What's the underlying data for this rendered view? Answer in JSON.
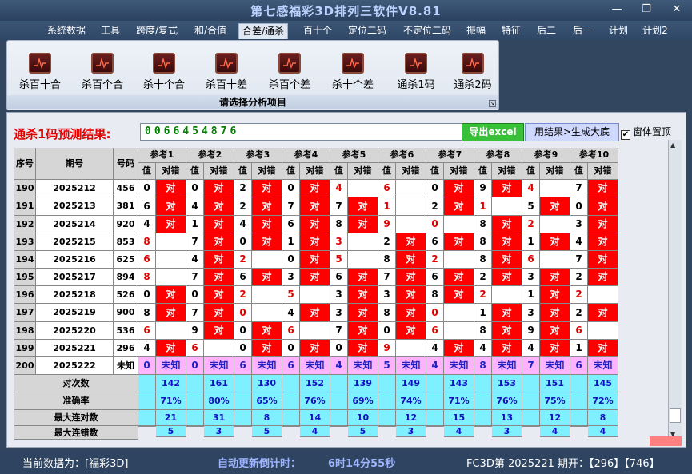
{
  "app": {
    "title": "第七感福彩3D排列三软件V8.81"
  },
  "menu": [
    "系统数据",
    "工具",
    "跨度/复式",
    "和/合值",
    "合差/通杀",
    "百十个",
    "定位二码",
    "不定位二码",
    "振幅",
    "特征",
    "后二",
    "后一",
    "计划",
    "计划2"
  ],
  "menu_active": 4,
  "ribbon": {
    "buttons": [
      "杀百十合",
      "杀百个合",
      "杀十个合",
      "杀百十差",
      "杀百个差",
      "杀十个差",
      "通杀1码",
      "通杀2码"
    ],
    "caption": "请选择分析项目"
  },
  "prediction": {
    "label": "通杀1码预测结果:",
    "value": "0066454876",
    "export_label": "导出excel",
    "generate_label": "用结果>生成大底",
    "always_on_top": "窗体置顶"
  },
  "table": {
    "headers": {
      "seq": "序号",
      "period": "期号",
      "number": "号码",
      "value": "值",
      "hit": "对错"
    },
    "refs": [
      "参考1",
      "参考2",
      "参考3",
      "参考4",
      "参考5",
      "参考6",
      "参考7",
      "参考8",
      "参考9",
      "参考10"
    ],
    "rows": [
      {
        "seq": "190",
        "period": "2025212",
        "num": "456",
        "vals": [
          "0",
          "0",
          "2",
          "0",
          "4",
          "6",
          "0",
          "9",
          "4",
          "7"
        ],
        "hits": [
          1,
          1,
          1,
          1,
          0,
          0,
          1,
          1,
          0,
          1
        ]
      },
      {
        "seq": "191",
        "period": "2025213",
        "num": "381",
        "vals": [
          "6",
          "4",
          "2",
          "7",
          "7",
          "1",
          "2",
          "1",
          "5",
          "0"
        ],
        "hits": [
          1,
          1,
          1,
          1,
          1,
          0,
          1,
          0,
          1,
          1
        ]
      },
      {
        "seq": "192",
        "period": "2025214",
        "num": "920",
        "vals": [
          "4",
          "1",
          "4",
          "6",
          "8",
          "9",
          "0",
          "8",
          "2",
          "3"
        ],
        "hits": [
          1,
          1,
          1,
          1,
          1,
          0,
          0,
          1,
          0,
          1
        ]
      },
      {
        "seq": "193",
        "period": "2025215",
        "num": "853",
        "vals": [
          "8",
          "7",
          "0",
          "1",
          "3",
          "2",
          "6",
          "8",
          "1",
          "4"
        ],
        "hits": [
          0,
          1,
          1,
          1,
          0,
          1,
          1,
          1,
          1,
          1
        ]
      },
      {
        "seq": "194",
        "period": "2025216",
        "num": "625",
        "vals": [
          "6",
          "4",
          "2",
          "0",
          "5",
          "8",
          "2",
          "8",
          "6",
          "7"
        ],
        "hits": [
          0,
          1,
          0,
          1,
          0,
          1,
          0,
          1,
          0,
          1
        ]
      },
      {
        "seq": "195",
        "period": "2025217",
        "num": "894",
        "vals": [
          "8",
          "7",
          "6",
          "3",
          "6",
          "7",
          "6",
          "2",
          "3",
          "2"
        ],
        "hits": [
          0,
          1,
          1,
          1,
          1,
          1,
          1,
          1,
          1,
          1
        ]
      },
      {
        "seq": "196",
        "period": "2025218",
        "num": "526",
        "vals": [
          "0",
          "0",
          "2",
          "5",
          "3",
          "3",
          "8",
          "2",
          "1",
          "2"
        ],
        "hits": [
          1,
          1,
          0,
          0,
          1,
          1,
          1,
          0,
          1,
          0
        ]
      },
      {
        "seq": "197",
        "period": "2025219",
        "num": "900",
        "vals": [
          "8",
          "7",
          "0",
          "4",
          "3",
          "8",
          "0",
          "1",
          "3",
          "2"
        ],
        "hits": [
          1,
          1,
          0,
          1,
          1,
          1,
          0,
          1,
          1,
          1
        ]
      },
      {
        "seq": "198",
        "period": "2025220",
        "num": "536",
        "vals": [
          "6",
          "9",
          "0",
          "6",
          "7",
          "0",
          "6",
          "8",
          "9",
          "6"
        ],
        "hits": [
          0,
          1,
          1,
          0,
          1,
          1,
          0,
          1,
          1,
          0
        ]
      },
      {
        "seq": "199",
        "period": "2025221",
        "num": "296",
        "vals": [
          "4",
          "6",
          "0",
          "0",
          "0",
          "9",
          "4",
          "4",
          "4",
          "1"
        ],
        "hits": [
          1,
          0,
          1,
          1,
          1,
          0,
          1,
          1,
          1,
          1
        ]
      }
    ],
    "pending": {
      "seq": "200",
      "period": "2025222",
      "num": "未知",
      "vals": [
        "0",
        "0",
        "6",
        "6",
        "4",
        "5",
        "4",
        "8",
        "7",
        "6"
      ],
      "hit_text": "未知"
    },
    "mark": "对",
    "stats": [
      {
        "label": "对次数",
        "values": [
          "142",
          "161",
          "130",
          "152",
          "139",
          "149",
          "143",
          "153",
          "151",
          "145"
        ]
      },
      {
        "label": "准确率",
        "values": [
          "71%",
          "80%",
          "65%",
          "76%",
          "69%",
          "74%",
          "71%",
          "76%",
          "75%",
          "72%"
        ]
      },
      {
        "label": "最大连对数",
        "values": [
          "21",
          "31",
          "8",
          "14",
          "10",
          "12",
          "15",
          "13",
          "12",
          "8"
        ]
      },
      {
        "label": "最大连错数",
        "values": [
          "5",
          "3",
          "5",
          "4",
          "5",
          "3",
          "4",
          "3",
          "4",
          "4"
        ]
      }
    ]
  },
  "status": {
    "current": "当前数据为：[福彩3D]",
    "countdown_label": "自动更新倒计时：",
    "countdown": "6时14分55秒",
    "issue": "FC3D第 2025221 期开：【296】【746】"
  },
  "colors": {
    "hit": "#ff0000",
    "pending": "#ffb3ff",
    "stats": "#7ff0ff",
    "prediction": "#008000",
    "alert": "#e00000"
  }
}
